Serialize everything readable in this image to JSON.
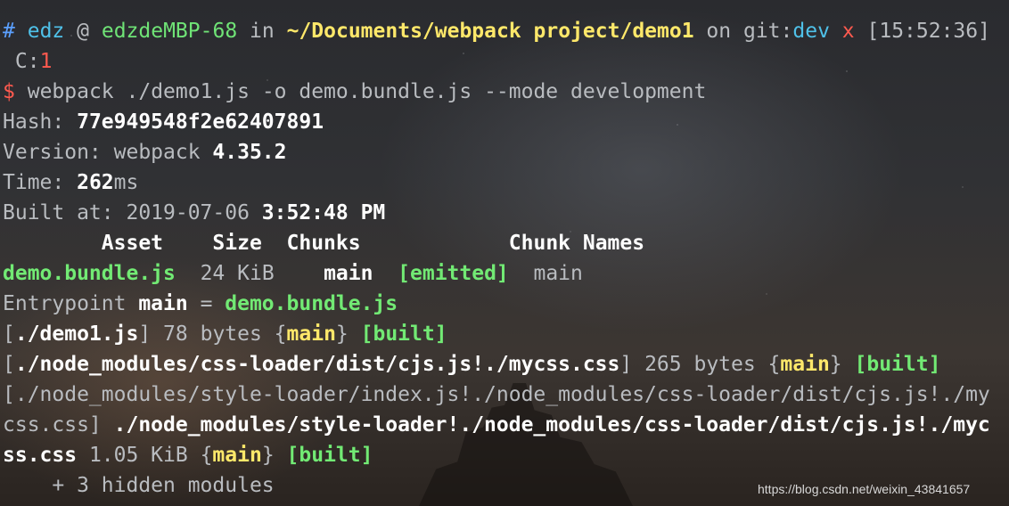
{
  "prompt": {
    "hash_symbol": "#",
    "user": "edz",
    "at": "@",
    "host": "edzdeMBP-68",
    "in": "in",
    "path": "~/Documents/webpack project/demo1",
    "on": "on",
    "git_label": "git:",
    "branch": "dev",
    "dirty": "x",
    "time": "[15:52:36]",
    "code_label": "C:",
    "code_value": "1"
  },
  "command": {
    "symbol": "$",
    "text": "webpack ./demo1.js -o demo.bundle.js --mode development"
  },
  "info": {
    "hash_label": "Hash: ",
    "hash_value": "77e949548f2e62407891",
    "version_label": "Version: webpack ",
    "version_value": "4.35.2",
    "time_label": "Time: ",
    "time_value": "262",
    "time_unit": "ms",
    "built_label": "Built at: 2019-07-06 ",
    "built_time": "3:52:48 PM"
  },
  "table": {
    "headers": [
      "Asset",
      "Size",
      "Chunks",
      "Chunk Names"
    ],
    "row": {
      "asset": "demo.bundle.js",
      "size": "24 KiB",
      "chunks": "main",
      "status": "[emitted]",
      "chunk_names": "main"
    }
  },
  "entrypoint": {
    "label": "Entrypoint ",
    "name": "main",
    "eq": " = ",
    "file": "demo.bundle.js"
  },
  "modules": {
    "m1_open": "[",
    "m1_path": "./demo1.js",
    "m1_close": "]",
    "m1_size": " 78 bytes {",
    "m1_chunk": "main",
    "m1_brace": "}",
    "m1_built": "[built]",
    "m2_open": "[",
    "m2_path": "./node_modules/css-loader/dist/cjs.js!./mycss.css",
    "m2_close": "]",
    "m2_size": " 265 bytes {",
    "m2_chunk": "main",
    "m2_brace": "}",
    "m2_built": "[built]",
    "m3_line1": "[./node_modules/style-loader/index.js!./node_modules/css-loader/dist/cjs.js!./my",
    "m3_line2_gray": "css.css] ",
    "m3_line2_bold": "./node_modules/style-loader!./node_modules/css-loader/dist/cjs.js!./myc",
    "m3_line3_bold": "ss.css",
    "m3_size": " 1.05 KiB {",
    "m3_chunk": "main",
    "m3_brace": "}",
    "m3_built": "[built]",
    "hidden": "    + 3 hidden modules"
  },
  "watermark": "https://blog.csdn.net/weixin_43841657",
  "colors": {
    "green": "#6fe376",
    "yellow": "#ffe86a",
    "cyan": "#4fc1e9",
    "blue": "#5ba0ff",
    "red": "#ff5a4f"
  }
}
